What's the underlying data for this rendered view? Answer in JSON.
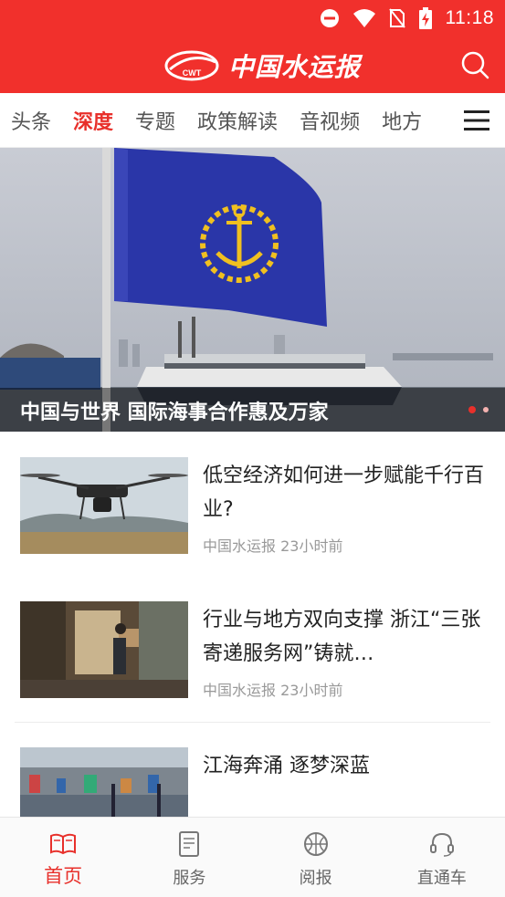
{
  "status_bar": {
    "time": "11:18"
  },
  "header": {
    "logo_text": "中国水运报",
    "logo_badge": "CWT"
  },
  "tabs": [
    {
      "label": "头条",
      "active": false
    },
    {
      "label": "深度",
      "active": true
    },
    {
      "label": "专题",
      "active": false
    },
    {
      "label": "政策解读",
      "active": false
    },
    {
      "label": "音视频",
      "active": false
    },
    {
      "label": "地方",
      "active": false
    }
  ],
  "banner": {
    "title": "中国与世界  国际海事合作惠及万家",
    "slide_index": 1,
    "slide_count": 2
  },
  "news": [
    {
      "title": "低空经济如何进一步赋能千行百业?",
      "source": "中国水运报",
      "time": "23小时前"
    },
    {
      "title": "行业与地方双向支撑  浙江“三张寄递服务网”铸就…",
      "source": "中国水运报",
      "time": "23小时前"
    },
    {
      "title": "江海奔涌  逐梦深蓝",
      "source": "",
      "time": ""
    }
  ],
  "bottom_nav": [
    {
      "label": "首页",
      "icon": "book-icon",
      "active": true
    },
    {
      "label": "服务",
      "icon": "document-icon",
      "active": false
    },
    {
      "label": "阅报",
      "icon": "basketball-icon",
      "active": false
    },
    {
      "label": "直通车",
      "icon": "headset-icon",
      "active": false
    }
  ],
  "colors": {
    "brand_red": "#f1302c",
    "accent_red": "#e8302b",
    "flag_blue": "#2a36a8"
  }
}
